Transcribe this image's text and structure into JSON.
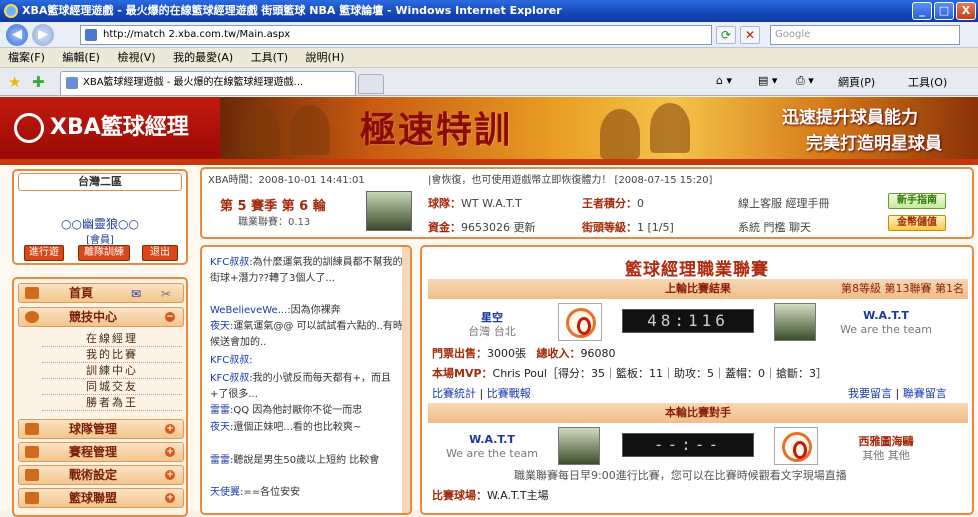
{
  "window": {
    "title": "XBA籃球經理遊戲 - 最火爆的在線籃球經理遊戲 街頭籃球 NBA 籃球論壇 - Windows Internet Explorer",
    "min": "_",
    "max": "□",
    "close": "X"
  },
  "address": {
    "url": "http://match 2.xba.com.tw/Main.aspx",
    "search_placeholder": "Google"
  },
  "menu": [
    "檔案(F)",
    "編輯(E)",
    "檢視(V)",
    "我的最愛(A)",
    "工具(T)",
    "說明(H)"
  ],
  "tab": {
    "label": "XBA籃球經理遊戲 - 最火爆的在線籃球經理遊戲...",
    "page_label": "網頁(P)",
    "tools_label": "工具(O)"
  },
  "header": {
    "logo_text": "XBA籃球經理",
    "banner_big": "極速特訓",
    "banner_line1": "迅速提升球員能力",
    "banner_line2": "完美打造明星球員"
  },
  "team_box": {
    "region": "台灣二區",
    "team_name": "○○幽靈狼○○",
    "member": "[會員]",
    "buttons": [
      "進行遊",
      "離隊訓練",
      "退出"
    ]
  },
  "nav": {
    "home": "首頁",
    "competition": "競技中心",
    "sub_items": [
      "在線經理",
      "我的比賽",
      "訓練中心",
      "同城交友",
      "勝者為王"
    ],
    "team_mgmt": "球隊管理",
    "schedule_mgmt": "賽程管理",
    "tactics": "戰術設定",
    "league": "籃球聯盟"
  },
  "status": {
    "time": "XBA時間：2008-10-01 14:41:01",
    "notice": "|會恢復，也可使用遊戲幣立即恢復體力！ [2008-07-15 15:20]",
    "season": "第 5 賽季 第 6 輪",
    "pro_rank": "職業聯賽：0.13",
    "team_label": "球隊：",
    "team_value": "WT W.A.T.T",
    "king_label": "王者積分：",
    "king_value": "0",
    "online": "線上客服 經理手冊",
    "funds_label": "資金：",
    "funds_value": "9653026 更新",
    "league_label": "街頭等級：",
    "league_value": "1 [1/5]",
    "links": "系統 門檻 聊天",
    "btn_guide": "新手指南",
    "btn_gold": "金幣儲值"
  },
  "chat": [
    {
      "who": "KFC叔叔:",
      "text": "為什麼運氣我的訓練員都不幫我的街球+潛力??轉了3個人了..."
    },
    {
      "who": "WeBelieveWe...:",
      "text": "因為你裸奔"
    },
    {
      "who": "夜天:",
      "text": "運氣運氣@@ 可以試試看六點的..有時候送會加的.."
    },
    {
      "who": "KFC叔叔:",
      "text": ""
    },
    {
      "who": "KFC叔叔:",
      "text": "我的小號反而每天都有+，而且+了很多..."
    },
    {
      "who": "雷雷:",
      "text": "QQ 因為他討厭你不從一而忠"
    },
    {
      "who": "夜天:",
      "text": "還個正妹吧...看的也比較爽~"
    },
    {
      "who": "雷雷:",
      "text": "聽說是男生50歲以上短約 比較會"
    },
    {
      "who": "天使翼:",
      "text": "==各位安安"
    }
  ],
  "match": {
    "title": "籃球經理職業聯賽",
    "last_header": "上輪比賽結果",
    "last_info": "第8等級 第13聯賽 第1名",
    "home_team": "星空",
    "home_city": "台灣 台北",
    "score_last": "48:116",
    "away_team": "W.A.T.T",
    "away_city": "We are the team",
    "attendance_label": "門票出售：",
    "attendance_value": "3000張",
    "income_label": "總收入：",
    "income_value": "96080",
    "mvp_label": "本場MVP：",
    "mvp_value": "Chris Poul［得分：35｜籃板：11｜助攻：5｜蓋帽：0｜搶斷：3］",
    "stats_link": "比賽統計",
    "report_link": "比賽戰報",
    "leave_msg": "我要留言",
    "league_msg": "聯賽留言",
    "next_header": "本輪比賽對手",
    "next_home": "W.A.T.T",
    "next_home_city": "We are the team",
    "score_next": "--:--",
    "next_away": "西雅圖海鷗",
    "next_away_city": "其他 其他",
    "schedule_note": "職業聯賽每日早9:00進行比賽，您可以在比賽時候觀看文字現場直播",
    "venue_label": "比賽球場：",
    "venue_value": "W.A.T.T主場"
  }
}
